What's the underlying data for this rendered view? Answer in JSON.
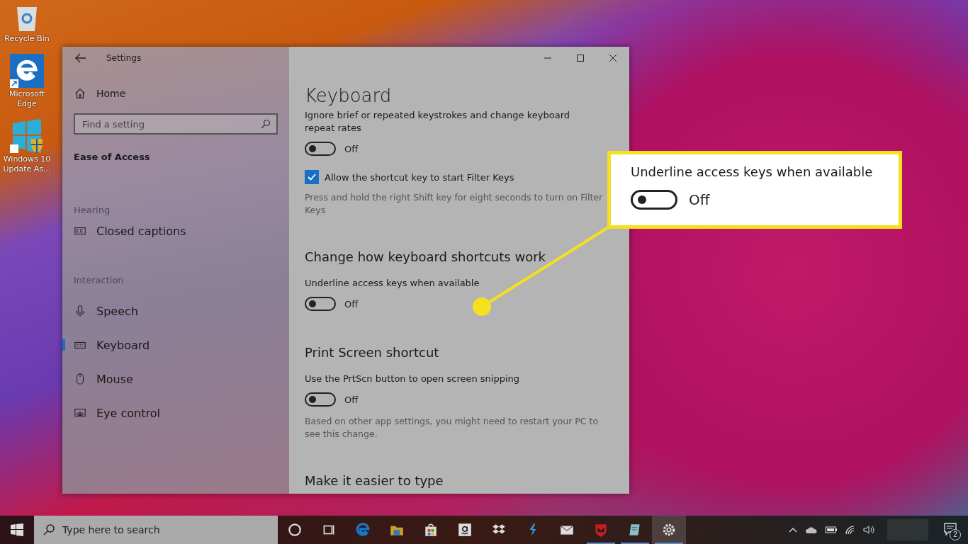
{
  "desktop_icons": [
    {
      "label": "Recycle Bin",
      "kind": "recycle"
    },
    {
      "label": "Microsoft Edge",
      "kind": "edge"
    },
    {
      "label": "Windows 10 Update As...",
      "kind": "update"
    }
  ],
  "window": {
    "title": "Settings"
  },
  "sidebar": {
    "home": "Home",
    "search": {
      "placeholder": "Find a setting"
    },
    "category": "Ease of Access",
    "groups": [
      {
        "heading": "Hearing",
        "items": [
          {
            "label": "Closed captions",
            "kind": "cc",
            "selected": false
          }
        ]
      },
      {
        "heading": "Interaction",
        "items": [
          {
            "label": "Speech",
            "kind": "mic",
            "selected": false
          },
          {
            "label": "Keyboard",
            "kind": "keyboard",
            "selected": true
          },
          {
            "label": "Mouse",
            "kind": "mouse",
            "selected": false
          },
          {
            "label": "Eye control",
            "kind": "eye",
            "selected": false
          }
        ]
      }
    ]
  },
  "content": {
    "title": "Keyboard",
    "items": [
      {
        "kind": "text",
        "text": "Ignore brief or repeated keystrokes and change keyboard repeat rates"
      },
      {
        "kind": "toggle",
        "on": false,
        "state_text": "Off"
      },
      {
        "kind": "checkbox",
        "checked": true,
        "text": "Allow the shortcut key to start Filter Keys"
      },
      {
        "kind": "note",
        "text": "Press and hold the right Shift key for eight seconds to turn on Filter Keys"
      },
      {
        "kind": "heading",
        "text": "Change how keyboard shortcuts work"
      },
      {
        "kind": "text",
        "text": "Underline access keys when available"
      },
      {
        "kind": "toggle",
        "on": false,
        "state_text": "Off"
      },
      {
        "kind": "heading",
        "text": "Print Screen shortcut"
      },
      {
        "kind": "text",
        "text": "Use the PrtScn button to open screen snipping"
      },
      {
        "kind": "toggle",
        "on": false,
        "state_text": "Off"
      },
      {
        "kind": "note",
        "text": "Based on other app settings, you might need to restart your PC to see this change."
      },
      {
        "kind": "heading",
        "text": "Make it easier to type"
      }
    ]
  },
  "callout": {
    "label": "Underline access keys when available",
    "on": false,
    "state_text": "Off"
  },
  "taskbar": {
    "search": {
      "placeholder": "Type here to search"
    },
    "apps": [
      {
        "kind": "cortana",
        "running": false,
        "selected": false
      },
      {
        "kind": "taskview",
        "running": false,
        "selected": false
      },
      {
        "kind": "edge",
        "running": false,
        "selected": false
      },
      {
        "kind": "folder",
        "running": false,
        "selected": false
      },
      {
        "kind": "store",
        "running": false,
        "selected": false
      },
      {
        "kind": "amazon",
        "running": false,
        "selected": false
      },
      {
        "kind": "dropbox",
        "running": false,
        "selected": false
      },
      {
        "kind": "bolt",
        "running": false,
        "selected": false
      },
      {
        "kind": "mail",
        "running": false,
        "selected": false
      },
      {
        "kind": "shield",
        "running": true,
        "selected": false
      },
      {
        "kind": "notepad",
        "running": true,
        "selected": false
      },
      {
        "kind": "gear",
        "running": true,
        "selected": true
      }
    ],
    "notification_count": "2"
  }
}
